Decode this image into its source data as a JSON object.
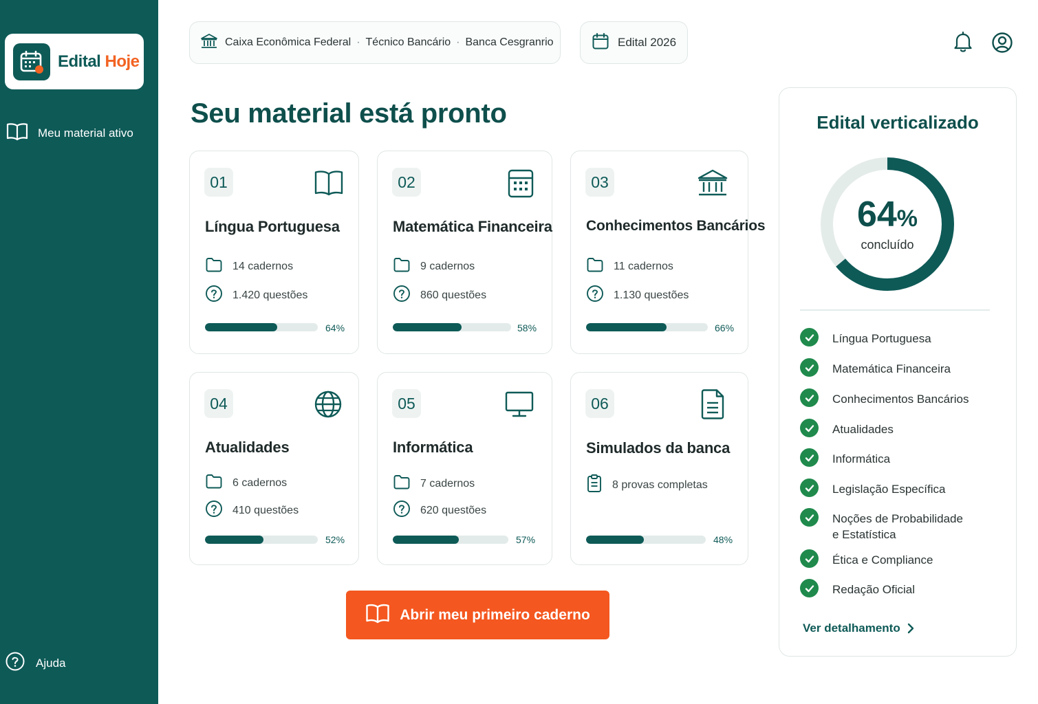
{
  "brand": {
    "name_part1": "Edital",
    "name_part2": "Hoje",
    "primary": "#0e5a57",
    "accent": "#f26322"
  },
  "sidebar": {
    "items": [
      {
        "label": "Meu material ativo",
        "icon": "open-book-icon"
      }
    ],
    "help": {
      "label": "Ajuda",
      "icon": "help-circle-icon"
    }
  },
  "header": {
    "breadcrumb": {
      "institution": "Caixa Econômica Federal",
      "role": "Técnico Bancário",
      "board": "Banca Cesgranrio"
    },
    "edital": "Edital 2026",
    "icons": [
      "bell-icon",
      "user-icon"
    ]
  },
  "main": {
    "title": "Seu material está pronto",
    "cards": [
      {
        "num": "01",
        "title": "Língua Portuguesa",
        "icon": "book-icon",
        "stat1": "14 cadernos",
        "stat2": "1.420 questões",
        "progress": 64,
        "pct_label": "64%"
      },
      {
        "num": "02",
        "title": "Matemática Financeira",
        "icon": "calculator-icon",
        "stat1": "9 cadernos",
        "stat2": "860 questões",
        "progress": 58,
        "pct_label": "58%"
      },
      {
        "num": "03",
        "title": "Conhecimentos Bancários",
        "icon": "bank-icon",
        "stat1": "11 cadernos",
        "stat2": "1.130 questões",
        "progress": 66,
        "pct_label": "66%"
      },
      {
        "num": "04",
        "title": "Atualidades",
        "icon": "globe-icon",
        "stat1": "6 cadernos",
        "stat2": "410 questões",
        "progress": 52,
        "pct_label": "52%"
      },
      {
        "num": "05",
        "title": "Informática",
        "icon": "monitor-icon",
        "stat1": "7 cadernos",
        "stat2": "620 questões",
        "progress": 57,
        "pct_label": "57%"
      },
      {
        "num": "06",
        "title": "Simulados da banca",
        "icon": "document-icon",
        "stat1": "8 provas completas",
        "progress": 48,
        "pct_label": "48%"
      }
    ],
    "cta_label": "Abrir meu primeiro caderno"
  },
  "panel": {
    "title": "Edital verticalizado",
    "progress_value": "64",
    "progress_unit": "%",
    "progress_fraction": 0.64,
    "progress_label": "concluído",
    "items": [
      "Língua Portuguesa",
      "Matemática Financeira",
      "Conhecimentos Bancários",
      "Atualidades",
      "Informática",
      "Legislação Específica",
      "Noções de Probabilidade e Estatística",
      "Ética e Compliance",
      "Redação Oficial"
    ],
    "detail_link": "Ver detalhamento"
  }
}
